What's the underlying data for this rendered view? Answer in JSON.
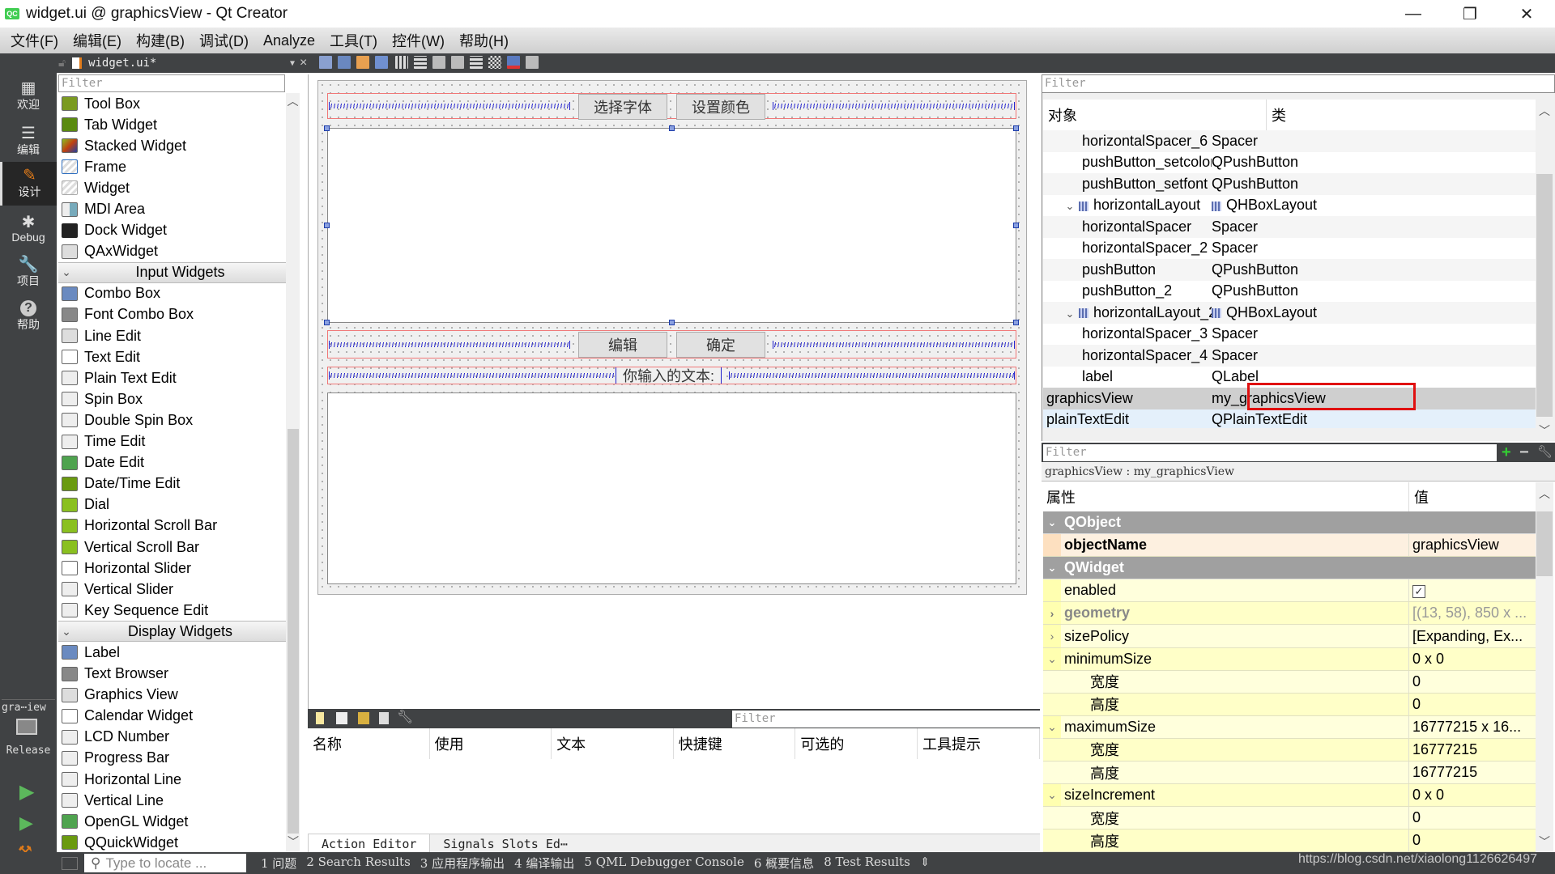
{
  "window": {
    "title": "widget.ui @ graphicsView - Qt Creator",
    "logo": "QC",
    "minimize": "—",
    "restore": "❐",
    "close": "✕"
  },
  "menu": [
    "文件(F)",
    "编辑(E)",
    "构建(B)",
    "调试(D)",
    "Analyze",
    "工具(T)",
    "控件(W)",
    "帮助(H)"
  ],
  "editor_toolbar": {
    "document": "widget.ui*",
    "close": "×"
  },
  "modes": [
    {
      "label": "欢迎",
      "icon": "▦"
    },
    {
      "label": "编辑",
      "icon": "☰"
    },
    {
      "label": "设计",
      "icon": "✎"
    },
    {
      "label": "Debug",
      "icon": "✱"
    },
    {
      "label": "项目",
      "icon": "🔧"
    },
    {
      "label": "帮助",
      "icon": "?"
    }
  ],
  "kit": {
    "project": "gra⋯iew",
    "config": "Release"
  },
  "widget_box": {
    "filter_placeholder": "Filter",
    "containers": [
      "Tool Box",
      "Tab Widget",
      "Stacked Widget",
      "Frame",
      "Widget",
      "MDI Area",
      "Dock Widget",
      "QAxWidget"
    ],
    "input_category": "Input Widgets",
    "input": [
      "Combo Box",
      "Font Combo Box",
      "Line Edit",
      "Text Edit",
      "Plain Text Edit",
      "Spin Box",
      "Double Spin Box",
      "Time Edit",
      "Date Edit",
      "Date/Time Edit",
      "Dial",
      "Horizontal Scroll Bar",
      "Vertical Scroll Bar",
      "Horizontal Slider",
      "Vertical Slider",
      "Key Sequence Edit"
    ],
    "display_category": "Display Widgets",
    "display": [
      "Label",
      "Text Browser",
      "Graphics View",
      "Calendar Widget",
      "LCD Number",
      "Progress Bar",
      "Horizontal Line",
      "Vertical Line",
      "OpenGL Widget",
      "QQuickWidget"
    ]
  },
  "form": {
    "btn_font": "选择字体",
    "btn_color": "设置颜色",
    "btn_edit": "编辑",
    "btn_ok": "确定",
    "label_text": "你输入的文本:"
  },
  "action_editor": {
    "filter_placeholder": "Filter",
    "columns": [
      "名称",
      "使用",
      "文本",
      "快捷键",
      "可选的",
      "工具提示"
    ],
    "tabs": [
      "Action Editor",
      "Signals  Slots Ed⋯"
    ]
  },
  "object_inspector": {
    "filter_placeholder": "Filter",
    "col_object": "对象",
    "col_class": "类",
    "rows": [
      {
        "object": "horizontalSpacer_6",
        "class": "Spacer",
        "level": 2
      },
      {
        "object": "pushButton_setcolor",
        "class": "QPushButton",
        "level": 2
      },
      {
        "object": "pushButton_setfont",
        "class": "QPushButton",
        "level": 2
      },
      {
        "object": "horizontalLayout",
        "class": "QHBoxLayout",
        "level": 1,
        "layout": true
      },
      {
        "object": "horizontalSpacer",
        "class": "Spacer",
        "level": 2
      },
      {
        "object": "horizontalSpacer_2",
        "class": "Spacer",
        "level": 2
      },
      {
        "object": "pushButton",
        "class": "QPushButton",
        "level": 2
      },
      {
        "object": "pushButton_2",
        "class": "QPushButton",
        "level": 2
      },
      {
        "object": "horizontalLayout_2",
        "class": "QHBoxLayout",
        "level": 1,
        "layout": true
      },
      {
        "object": "horizontalSpacer_3",
        "class": "Spacer",
        "level": 2
      },
      {
        "object": "horizontalSpacer_4",
        "class": "Spacer",
        "level": 2
      },
      {
        "object": "label",
        "class": "QLabel",
        "level": 2
      },
      {
        "object": "graphicsView",
        "class": "my_graphicsView",
        "level": 0,
        "selected": true
      },
      {
        "object": "plainTextEdit",
        "class": "QPlainTextEdit",
        "level": 0
      }
    ]
  },
  "property_editor": {
    "filter_placeholder": "Filter",
    "selection": "graphicsView : my_graphicsView",
    "col_property": "属性",
    "col_value": "值",
    "rows": [
      {
        "type": "group",
        "name": "QObject"
      },
      {
        "type": "prop",
        "name": "objectName",
        "value": "graphicsView",
        "bold": true,
        "color": "#fdf0e0"
      },
      {
        "type": "group",
        "name": "QWidget"
      },
      {
        "type": "prop",
        "name": "enabled",
        "value": "☑",
        "checkbox": true
      },
      {
        "type": "prop",
        "name": "geometry",
        "value": "[(13, 58), 850 x ...",
        "expand": "›",
        "dim": true
      },
      {
        "type": "prop",
        "name": "sizePolicy",
        "value": "[Expanding, Ex...",
        "expand": "›"
      },
      {
        "type": "prop",
        "name": "minimumSize",
        "value": "0 x 0",
        "expand": "⌄"
      },
      {
        "type": "sub",
        "name": "宽度",
        "value": "0"
      },
      {
        "type": "sub",
        "name": "高度",
        "value": "0"
      },
      {
        "type": "prop",
        "name": "maximumSize",
        "value": "16777215 x 16...",
        "expand": "⌄"
      },
      {
        "type": "sub",
        "name": "宽度",
        "value": "16777215"
      },
      {
        "type": "sub",
        "name": "高度",
        "value": "16777215"
      },
      {
        "type": "prop",
        "name": "sizeIncrement",
        "value": "0 x 0",
        "expand": "⌄"
      },
      {
        "type": "sub",
        "name": "宽度",
        "value": "0"
      },
      {
        "type": "sub",
        "name": "高度",
        "value": "0"
      }
    ]
  },
  "statusbar": {
    "locate_placeholder": "Type to locate ...",
    "items": [
      "1 问题",
      "2 Search Results",
      "3 应用程序输出",
      "4 编译输出",
      "5 QML Debugger Console",
      "6 概要信息",
      "8 Test Results",
      "⇕"
    ],
    "watermark": "https://blog.csdn.net/xiaolong1126626497"
  },
  "colors": {
    "accent_mode": "#e07b1a",
    "selection_red": "#e01010",
    "layout_red": "#f07878",
    "spacer_blue": "#2222cc",
    "property_yellow": "#ffffdc"
  }
}
